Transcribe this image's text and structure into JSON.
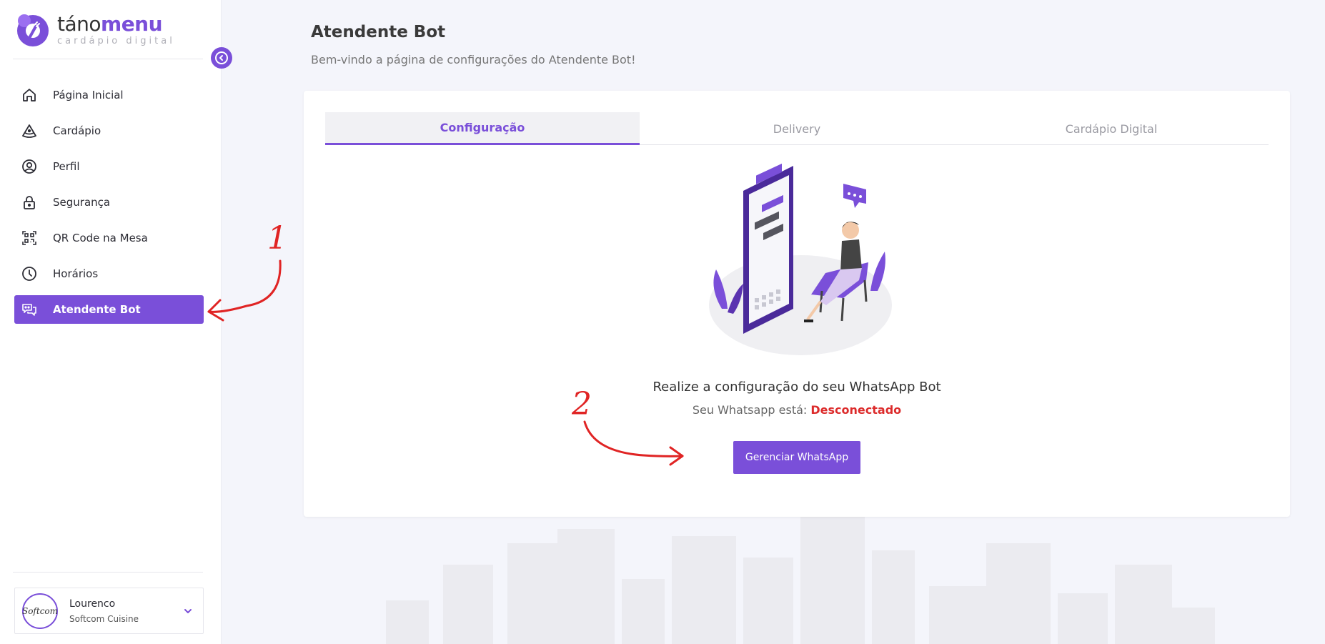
{
  "brand": {
    "name_part1": "táno",
    "name_part2": "menu",
    "tagline": "cardápio digital",
    "accent_color": "#7a4fd9"
  },
  "sidebar": {
    "items": [
      {
        "label": "Página Inicial",
        "icon": "home-icon",
        "active": false
      },
      {
        "label": "Cardápio",
        "icon": "pizza-slice-icon",
        "active": false
      },
      {
        "label": "Perfil",
        "icon": "user-circle-icon",
        "active": false
      },
      {
        "label": "Segurança",
        "icon": "lock-icon",
        "active": false
      },
      {
        "label": "QR Code na Mesa",
        "icon": "qr-code-icon",
        "active": false
      },
      {
        "label": "Horários",
        "icon": "clock-icon",
        "active": false
      },
      {
        "label": "Atendente Bot",
        "icon": "chat-bot-icon",
        "active": true
      }
    ],
    "user": {
      "name": "Lourenco",
      "company": "Softcom Cuisine",
      "avatar_text": "Softcom"
    }
  },
  "page": {
    "title": "Atendente Bot",
    "subtitle": "Bem-vindo a página de configurações do Atendente Bot!"
  },
  "tabs": [
    {
      "label": "Configuração",
      "active": true
    },
    {
      "label": "Delivery",
      "active": false
    },
    {
      "label": "Cardápio Digital",
      "active": false
    }
  ],
  "whatsapp": {
    "setup_title": "Realize a configuração do seu WhatsApp Bot",
    "status_prefix": "Seu Whatsapp está:",
    "status_value": "Desconectado",
    "status_color": "#dc2b2b",
    "manage_button": "Gerenciar WhatsApp"
  },
  "annotations": {
    "marker_1": "1",
    "marker_2": "2",
    "color": "#e02424"
  }
}
